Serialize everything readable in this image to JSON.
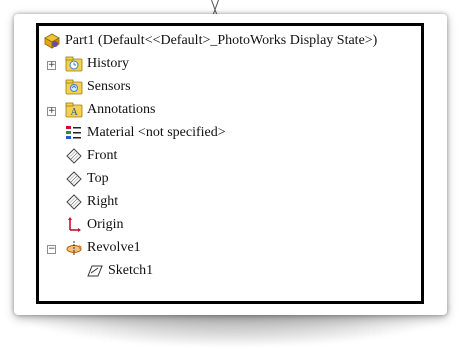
{
  "tree": {
    "root": {
      "label": "Part1  (Default<<Default>_PhotoWorks Display State>)"
    },
    "items": [
      {
        "label": "History"
      },
      {
        "label": "Sensors"
      },
      {
        "label": "Annotations"
      },
      {
        "label": "Material <not specified>"
      },
      {
        "label": "Front"
      },
      {
        "label": "Top"
      },
      {
        "label": "Right"
      },
      {
        "label": "Origin"
      },
      {
        "label": "Revolve1"
      },
      {
        "label": "Sketch1"
      }
    ]
  },
  "colors": {
    "frame_border": "#000000",
    "folder_yellow": "#f4d24e",
    "folder_blue_accent": "#3d7fd6",
    "origin_red": "#c8102e",
    "revolve_orange": "#e07a1f"
  },
  "icons": {
    "root": "part-icon",
    "history": "history-folder-icon",
    "sensors": "sensor-icon",
    "annotations": "annotations-icon",
    "material": "material-icon",
    "plane": "plane-icon",
    "origin": "origin-icon",
    "revolve": "revolve-icon",
    "sketch": "sketch-icon"
  }
}
